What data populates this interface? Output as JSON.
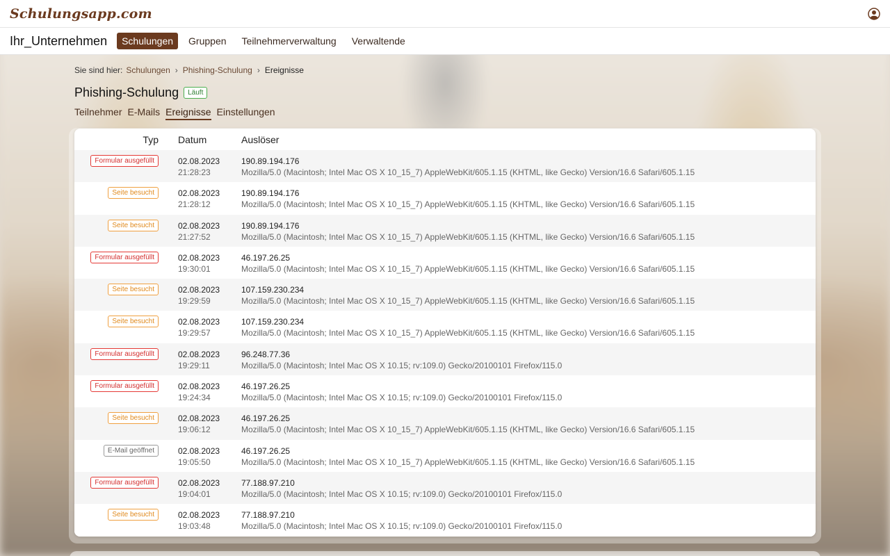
{
  "app": {
    "logo": "Schulungsapp.com"
  },
  "nav": {
    "company": "Ihr_Unternehmen",
    "links": [
      "Schulungen",
      "Gruppen",
      "Teilnehmerverwaltung",
      "Verwaltende"
    ]
  },
  "breadcrumb": {
    "prefix": "Sie sind hier:",
    "items": [
      "Schulungen",
      "Phishing-Schulung"
    ],
    "current": "Ereignisse"
  },
  "page": {
    "title": "Phishing-Schulung",
    "status": "Läuft"
  },
  "subtabs": [
    "Teilnehmer",
    "E-Mails",
    "Ereignisse",
    "Einstellungen"
  ],
  "table": {
    "headers": {
      "type": "Typ",
      "date": "Datum",
      "trigger": "Auslöser"
    },
    "rows": [
      {
        "type": "Formular ausgefüllt",
        "kind": "red",
        "date": "02.08.2023",
        "time": "21:28:23",
        "ip": "190.89.194.176",
        "ua": "Mozilla/5.0 (Macintosh; Intel Mac OS X 10_15_7) AppleWebKit/605.1.15 (KHTML, like Gecko) Version/16.6 Safari/605.1.15"
      },
      {
        "type": "Seite besucht",
        "kind": "orange",
        "date": "02.08.2023",
        "time": "21:28:12",
        "ip": "190.89.194.176",
        "ua": "Mozilla/5.0 (Macintosh; Intel Mac OS X 10_15_7) AppleWebKit/605.1.15 (KHTML, like Gecko) Version/16.6 Safari/605.1.15"
      },
      {
        "type": "Seite besucht",
        "kind": "orange",
        "date": "02.08.2023",
        "time": "21:27:52",
        "ip": "190.89.194.176",
        "ua": "Mozilla/5.0 (Macintosh; Intel Mac OS X 10_15_7) AppleWebKit/605.1.15 (KHTML, like Gecko) Version/16.6 Safari/605.1.15"
      },
      {
        "type": "Formular ausgefüllt",
        "kind": "red",
        "date": "02.08.2023",
        "time": "19:30:01",
        "ip": "46.197.26.25",
        "ua": "Mozilla/5.0 (Macintosh; Intel Mac OS X 10_15_7) AppleWebKit/605.1.15 (KHTML, like Gecko) Version/16.6 Safari/605.1.15"
      },
      {
        "type": "Seite besucht",
        "kind": "orange",
        "date": "02.08.2023",
        "time": "19:29:59",
        "ip": "107.159.230.234",
        "ua": "Mozilla/5.0 (Macintosh; Intel Mac OS X 10_15_7) AppleWebKit/605.1.15 (KHTML, like Gecko) Version/16.6 Safari/605.1.15"
      },
      {
        "type": "Seite besucht",
        "kind": "orange",
        "date": "02.08.2023",
        "time": "19:29:57",
        "ip": "107.159.230.234",
        "ua": "Mozilla/5.0 (Macintosh; Intel Mac OS X 10_15_7) AppleWebKit/605.1.15 (KHTML, like Gecko) Version/16.6 Safari/605.1.15"
      },
      {
        "type": "Formular ausgefüllt",
        "kind": "red",
        "date": "02.08.2023",
        "time": "19:29:11",
        "ip": "96.248.77.36",
        "ua": "Mozilla/5.0 (Macintosh; Intel Mac OS X 10.15; rv:109.0) Gecko/20100101 Firefox/115.0"
      },
      {
        "type": "Formular ausgefüllt",
        "kind": "red",
        "date": "02.08.2023",
        "time": "19:24:34",
        "ip": "46.197.26.25",
        "ua": "Mozilla/5.0 (Macintosh; Intel Mac OS X 10.15; rv:109.0) Gecko/20100101 Firefox/115.0"
      },
      {
        "type": "Seite besucht",
        "kind": "orange",
        "date": "02.08.2023",
        "time": "19:06:12",
        "ip": "46.197.26.25",
        "ua": "Mozilla/5.0 (Macintosh; Intel Mac OS X 10_15_7) AppleWebKit/605.1.15 (KHTML, like Gecko) Version/16.6 Safari/605.1.15"
      },
      {
        "type": "E-Mail geöffnet",
        "kind": "gray",
        "date": "02.08.2023",
        "time": "19:05:50",
        "ip": "46.197.26.25",
        "ua": "Mozilla/5.0 (Macintosh; Intel Mac OS X 10_15_7) AppleWebKit/605.1.15 (KHTML, like Gecko) Version/16.6 Safari/605.1.15"
      },
      {
        "type": "Formular ausgefüllt",
        "kind": "red",
        "date": "02.08.2023",
        "time": "19:04:01",
        "ip": "77.188.97.210",
        "ua": "Mozilla/5.0 (Macintosh; Intel Mac OS X 10.15; rv:109.0) Gecko/20100101 Firefox/115.0"
      },
      {
        "type": "Seite besucht",
        "kind": "orange",
        "date": "02.08.2023",
        "time": "19:03:48",
        "ip": "77.188.97.210",
        "ua": "Mozilla/5.0 (Macintosh; Intel Mac OS X 10.15; rv:109.0) Gecko/20100101 Firefox/115.0"
      }
    ]
  },
  "colors": {
    "brand": "#6b3a1f",
    "status_green": "#2e7d32",
    "badge_red": "#d32f2f",
    "badge_orange": "#e08a1e",
    "badge_gray": "#666666"
  },
  "icons": {
    "user": "user-circle-icon"
  }
}
